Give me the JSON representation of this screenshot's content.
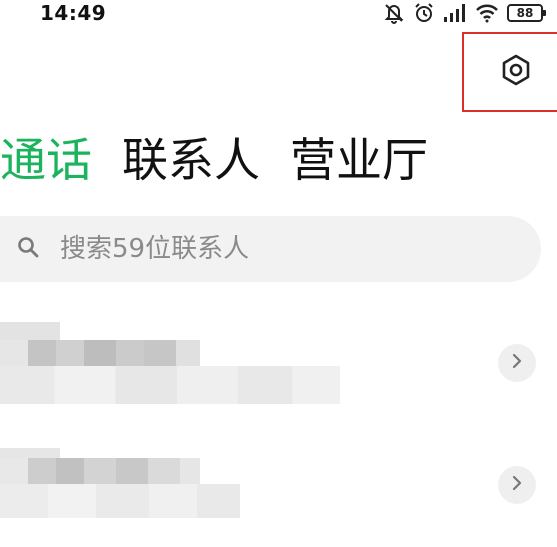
{
  "status_bar": {
    "time": "14:49",
    "battery": "88",
    "icons": [
      "mute-icon",
      "alarm-icon",
      "signal-icon",
      "wifi-icon",
      "battery-icon"
    ]
  },
  "header": {
    "settings_icon": "hexagon-settings-icon",
    "highlight_color": "#d9302c"
  },
  "tabs": [
    {
      "label": "通话",
      "active": true
    },
    {
      "label": "联系人",
      "active": false
    },
    {
      "label": "营业厅",
      "active": false
    }
  ],
  "accent_color": "#1bb35c",
  "search": {
    "placeholder": "搜索59位联系人",
    "value": ""
  },
  "contacts": [
    {
      "name": "",
      "detail": "",
      "blurred": true
    },
    {
      "name": "",
      "detail": "",
      "blurred": true
    }
  ]
}
